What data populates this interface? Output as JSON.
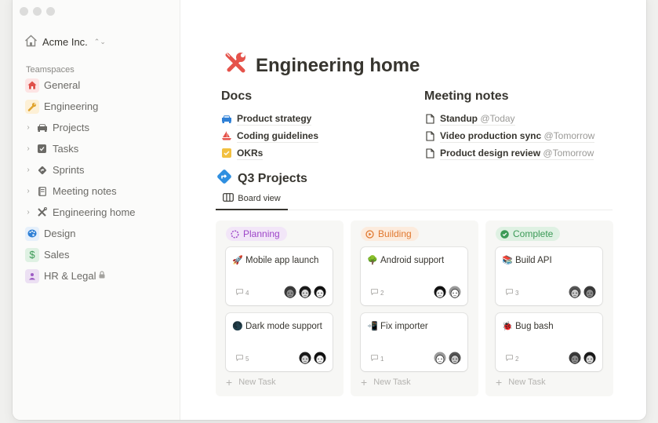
{
  "window": {
    "traffic_lights": [
      "close",
      "minimize",
      "zoom"
    ]
  },
  "sidebar": {
    "workspace": {
      "name": "Acme Inc.",
      "icon": "home-icon"
    },
    "section_label": "Teamspaces",
    "items": [
      {
        "label": "General",
        "icon": "house-icon",
        "emoji": "🏠",
        "bg": "#fde4e4",
        "child": false
      },
      {
        "label": "Engineering",
        "icon": "wrench-icon",
        "emoji": "🔧",
        "bg": "#fdf0d6",
        "child": false
      },
      {
        "label": "Projects",
        "icon": "car-icon",
        "child": true
      },
      {
        "label": "Tasks",
        "icon": "checkbox-icon",
        "child": true
      },
      {
        "label": "Sprints",
        "icon": "direction-sign-icon",
        "child": true
      },
      {
        "label": "Meeting notes",
        "icon": "notebook-icon",
        "child": true
      },
      {
        "label": "Engineering home",
        "icon": "tools-icon",
        "child": true
      },
      {
        "label": "Design",
        "icon": "palette-icon",
        "emoji": "🎨",
        "bg": "#e6f0fb",
        "child": false
      },
      {
        "label": "Sales",
        "icon": "dollar-icon",
        "emoji": "$",
        "bg": "#dff1e3",
        "child": false
      },
      {
        "label": "HR & Legal",
        "icon": "person-icon",
        "bg": "#ece0f3",
        "child": false,
        "locked": true
      }
    ]
  },
  "page": {
    "title": "Engineering home",
    "title_icon": "tools-icon",
    "docs": {
      "heading": "Docs",
      "items": [
        {
          "label": "Product strategy",
          "icon": "car-icon"
        },
        {
          "label": "Coding guidelines",
          "icon": "sailboat-icon"
        },
        {
          "label": "OKRs",
          "icon": "checkbox-icon"
        }
      ]
    },
    "meeting_notes": {
      "heading": "Meeting notes",
      "items": [
        {
          "label": "Standup",
          "mention": "@Today"
        },
        {
          "label": "Video production sync",
          "mention": "@Tomorrow"
        },
        {
          "label": "Product design review",
          "mention": "@Tomorrow"
        }
      ]
    },
    "projects": {
      "heading": "Q3 Projects",
      "icon": "direction-sign-icon",
      "tab": "Board view",
      "new_task_label": "New Task",
      "columns": [
        {
          "status": "Planning",
          "color": "#9d46c8",
          "bg": "#f2e6f8",
          "cards": [
            {
              "title": "Mobile app launch",
              "emoji": "🚀",
              "comments": "4",
              "avatars": 3
            },
            {
              "title": "Dark mode support",
              "emoji": "🌑",
              "comments": "5",
              "avatars": 2
            }
          ]
        },
        {
          "status": "Building",
          "color": "#e0782f",
          "bg": "#fcebdd",
          "cards": [
            {
              "title": "Android support",
              "emoji": "🌳",
              "comments": "2",
              "avatars": 2
            },
            {
              "title": "Fix importer",
              "emoji": "📲",
              "comments": "1",
              "avatars": 2
            }
          ]
        },
        {
          "status": "Complete",
          "color": "#3c9a57",
          "bg": "#dff1e3",
          "cards": [
            {
              "title": "Build API",
              "emoji": "📚",
              "comments": "3",
              "avatars": 2
            },
            {
              "title": "Bug bash",
              "emoji": "🐞",
              "comments": "2",
              "avatars": 2
            }
          ]
        }
      ]
    }
  }
}
